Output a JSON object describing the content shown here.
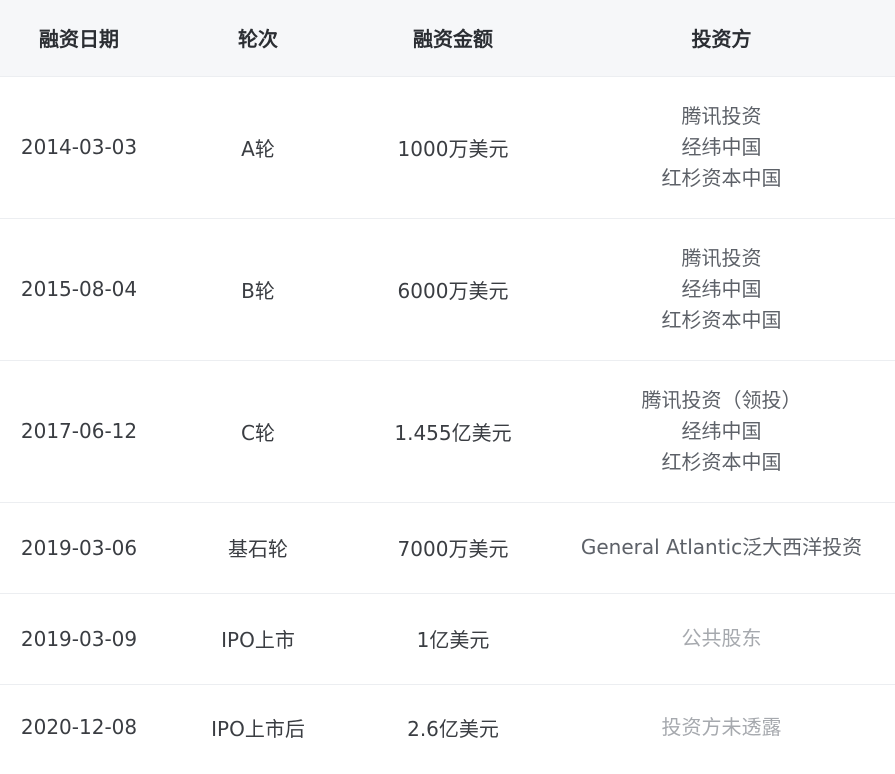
{
  "table": {
    "headers": {
      "date": "融资日期",
      "round": "轮次",
      "amount": "融资金额",
      "investor": "投资方"
    },
    "rows": [
      {
        "date": "2014-03-03",
        "round": "A轮",
        "amount": "1000万美元",
        "investors": [
          "腾讯投资",
          "经纬中国",
          "红杉资本中国"
        ]
      },
      {
        "date": "2015-08-04",
        "round": "B轮",
        "amount": "6000万美元",
        "investors": [
          "腾讯投资",
          "经纬中国",
          "红杉资本中国"
        ]
      },
      {
        "date": "2017-06-12",
        "round": "C轮",
        "amount": "1.455亿美元",
        "investors": [
          "腾讯投资（领投）",
          "经纬中国",
          "红杉资本中国"
        ]
      },
      {
        "date": "2019-03-06",
        "round": "基石轮",
        "amount": "7000万美元",
        "investors": [
          "General Atlantic泛大西洋投资"
        ]
      },
      {
        "date": "2019-03-09",
        "round": "IPO上市",
        "amount": "1亿美元",
        "investors": [
          "公共股东"
        ],
        "muted": true
      },
      {
        "date": "2020-12-08",
        "round": "IPO上市后",
        "amount": "2.6亿美元",
        "investors": [
          "投资方未透露"
        ],
        "muted": true
      }
    ]
  }
}
